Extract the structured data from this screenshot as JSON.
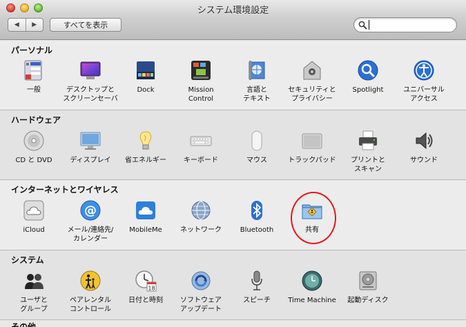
{
  "window": {
    "title": "システム環境設定"
  },
  "toolbar": {
    "back_glyph": "◀",
    "forward_glyph": "▶",
    "show_all_label": "すべてを表示",
    "search_value": "",
    "search_placeholder": ""
  },
  "sections": {
    "personal": {
      "title": "パーソナル",
      "items": [
        {
          "label": "一般",
          "icon": "general-icon"
        },
        {
          "label": "デスクトップと\nスクリーンセーバ",
          "icon": "desktop-screensaver-icon"
        },
        {
          "label": "Dock",
          "icon": "dock-icon"
        },
        {
          "label": "Mission\nControl",
          "icon": "mission-control-icon"
        },
        {
          "label": "言語と\nテキスト",
          "icon": "language-text-icon"
        },
        {
          "label": "セキュリティと\nプライバシー",
          "icon": "security-privacy-icon"
        },
        {
          "label": "Spotlight",
          "icon": "spotlight-icon"
        },
        {
          "label": "ユニバーサル\nアクセス",
          "icon": "universal-access-icon"
        }
      ]
    },
    "hardware": {
      "title": "ハードウェア",
      "items": [
        {
          "label": "CD と DVD",
          "icon": "cd-dvd-icon"
        },
        {
          "label": "ディスプレイ",
          "icon": "display-icon"
        },
        {
          "label": "省エネルギー",
          "icon": "energy-saver-icon"
        },
        {
          "label": "キーボード",
          "icon": "keyboard-icon"
        },
        {
          "label": "マウス",
          "icon": "mouse-icon"
        },
        {
          "label": "トラックパッド",
          "icon": "trackpad-icon"
        },
        {
          "label": "プリントと\nスキャン",
          "icon": "print-scan-icon"
        },
        {
          "label": "サウンド",
          "icon": "sound-icon"
        }
      ]
    },
    "internet": {
      "title": "インターネットとワイヤレス",
      "items": [
        {
          "label": "iCloud",
          "icon": "icloud-icon"
        },
        {
          "label": "メール/連絡先/\nカレンダー",
          "icon": "mail-contacts-calendar-icon"
        },
        {
          "label": "MobileMe",
          "icon": "mobileme-icon"
        },
        {
          "label": "ネットワーク",
          "icon": "network-icon"
        },
        {
          "label": "Bluetooth",
          "icon": "bluetooth-icon"
        },
        {
          "label": "共有",
          "icon": "sharing-icon"
        }
      ]
    },
    "system": {
      "title": "システム",
      "items": [
        {
          "label": "ユーザと\nグループ",
          "icon": "users-groups-icon"
        },
        {
          "label": "ペアレンタル\nコントロール",
          "icon": "parental-controls-icon"
        },
        {
          "label": "日付と時刻",
          "icon": "date-time-icon"
        },
        {
          "label": "ソフトウェア\nアップデート",
          "icon": "software-update-icon"
        },
        {
          "label": "スピーチ",
          "icon": "speech-icon"
        },
        {
          "label": "Time Machine",
          "icon": "time-machine-icon"
        },
        {
          "label": "起動ディスク",
          "icon": "startup-disk-icon"
        }
      ]
    },
    "other": {
      "title": "その他"
    }
  },
  "date_icon_day": "18",
  "colors": {
    "highlight_circle": "#e8141a",
    "accent_blue": "#2a6fd6"
  }
}
